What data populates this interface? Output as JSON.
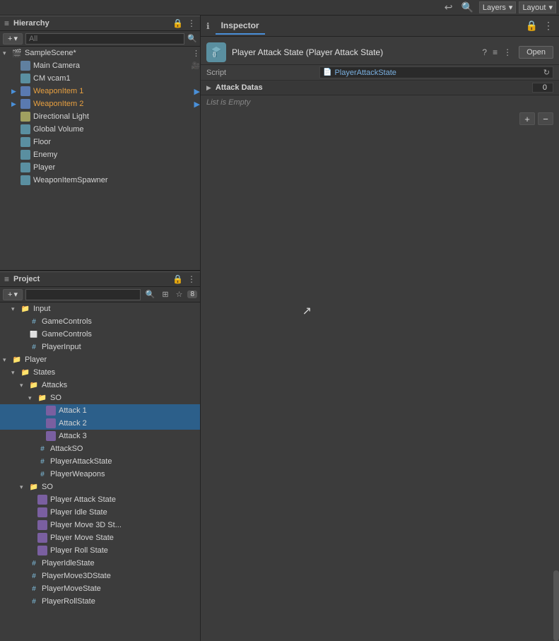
{
  "topbar": {
    "undo_icon": "↩",
    "search_icon": "🔍",
    "layers_label": "Layers",
    "layout_label": "Layout",
    "lock_icon": "🔒",
    "more_icon": "⋮",
    "chevron_icon": "▾"
  },
  "hierarchy": {
    "panel_title": "Hierarchy",
    "add_label": "+",
    "search_placeholder": "All",
    "items": [
      {
        "id": "samplescene",
        "label": "SampleScene*",
        "indent": 0,
        "expanded": true,
        "type": "scene",
        "selected": false
      },
      {
        "id": "maincamera",
        "label": "Main Camera",
        "indent": 1,
        "type": "camera",
        "selected": false,
        "has_component": true
      },
      {
        "id": "cmvcam1",
        "label": "CM vcam1",
        "indent": 1,
        "type": "gameobject",
        "selected": false
      },
      {
        "id": "weaponitem1",
        "label": "WeaponItem 1",
        "indent": 1,
        "type": "prefab",
        "expanded": false,
        "color": "orange",
        "selected": false
      },
      {
        "id": "weaponitem2",
        "label": "WeaponItem 2",
        "indent": 1,
        "type": "prefab",
        "expanded": false,
        "color": "orange",
        "selected": false
      },
      {
        "id": "directionallight",
        "label": "Directional Light",
        "indent": 1,
        "type": "light",
        "selected": false
      },
      {
        "id": "globalvolume",
        "label": "Global Volume",
        "indent": 1,
        "type": "gameobject",
        "selected": false
      },
      {
        "id": "floor",
        "label": "Floor",
        "indent": 1,
        "type": "gameobject",
        "selected": false
      },
      {
        "id": "enemy",
        "label": "Enemy",
        "indent": 1,
        "type": "gameobject",
        "selected": false
      },
      {
        "id": "player",
        "label": "Player",
        "indent": 1,
        "type": "gameobject",
        "selected": false
      },
      {
        "id": "weaponitemspawner",
        "label": "WeaponItemSpawner",
        "indent": 1,
        "type": "gameobject",
        "selected": false
      }
    ]
  },
  "inspector": {
    "panel_title": "Inspector",
    "component_title": "Player Attack State (Player Attack State)",
    "script_label": "Script",
    "script_value": "PlayerAttackState",
    "open_label": "Open",
    "attack_datas_label": "Attack Datas",
    "attack_datas_count": "0",
    "list_empty_label": "List is Empty",
    "add_icon": "+",
    "remove_icon": "−",
    "lock_icon": "🔒",
    "more_icon": "⋮",
    "question_icon": "?",
    "preset_icon": "≡",
    "more2_icon": "⋮"
  },
  "project": {
    "panel_title": "Project",
    "add_label": "+",
    "search_placeholder": "",
    "items": [
      {
        "id": "input",
        "label": "Input",
        "indent": 0,
        "type": "folder",
        "expanded": true
      },
      {
        "id": "gamecontrols1",
        "label": "GameControls",
        "indent": 1,
        "type": "script"
      },
      {
        "id": "gamecontrols2",
        "label": "GameControls",
        "indent": 1,
        "type": "script"
      },
      {
        "id": "playerinput",
        "label": "PlayerInput",
        "indent": 1,
        "type": "script"
      },
      {
        "id": "player_folder",
        "label": "Player",
        "indent": 0,
        "type": "folder",
        "expanded": true
      },
      {
        "id": "states_folder",
        "label": "States",
        "indent": 1,
        "type": "folder",
        "expanded": true
      },
      {
        "id": "attacks_folder",
        "label": "Attacks",
        "indent": 2,
        "type": "folder",
        "expanded": true
      },
      {
        "id": "so_folder",
        "label": "SO",
        "indent": 3,
        "type": "folder",
        "expanded": true
      },
      {
        "id": "attack1",
        "label": "Attack 1",
        "indent": 4,
        "type": "so",
        "selected": true
      },
      {
        "id": "attack2",
        "label": "Attack 2",
        "indent": 4,
        "type": "so",
        "selected": true
      },
      {
        "id": "attack3",
        "label": "Attack 3",
        "indent": 4,
        "type": "so",
        "selected": false
      },
      {
        "id": "attackso",
        "label": "AttackSO",
        "indent": 3,
        "type": "script"
      },
      {
        "id": "playerattackstate",
        "label": "PlayerAttackState",
        "indent": 3,
        "type": "script"
      },
      {
        "id": "playerweapons",
        "label": "PlayerWeapons",
        "indent": 3,
        "type": "script"
      },
      {
        "id": "so_folder2",
        "label": "SO",
        "indent": 2,
        "type": "folder",
        "expanded": true
      },
      {
        "id": "playerattackstate_so",
        "label": "Player Attack State",
        "indent": 3,
        "type": "so"
      },
      {
        "id": "playeridlestate_so",
        "label": "Player Idle State",
        "indent": 3,
        "type": "so"
      },
      {
        "id": "playermove3d_so",
        "label": "Player Move 3D St...",
        "indent": 3,
        "type": "so"
      },
      {
        "id": "playermovestate_so",
        "label": "Player Move State",
        "indent": 3,
        "type": "so"
      },
      {
        "id": "playerrollstate_so",
        "label": "Player Roll State",
        "indent": 3,
        "type": "so"
      },
      {
        "id": "playeridlestate_scr",
        "label": "PlayerIdleState",
        "indent": 2,
        "type": "script"
      },
      {
        "id": "playermove3dstate_scr",
        "label": "PlayerMove3DState",
        "indent": 2,
        "type": "script"
      },
      {
        "id": "playermovestate_scr",
        "label": "PlayerMoveState",
        "indent": 2,
        "type": "script"
      },
      {
        "id": "playerrollstate_scr",
        "label": "PlayerRollState",
        "indent": 2,
        "type": "script"
      }
    ]
  },
  "colors": {
    "accent_blue": "#4a90d9",
    "selected_bg": "#2c5f8a",
    "selected_bg2": "#1a4a6a",
    "folder_yellow": "#d4a84b",
    "script_blue": "#80c0e0",
    "so_purple": "#7a5fa0",
    "panel_bg": "#383838",
    "content_bg": "#3c3c3c"
  }
}
